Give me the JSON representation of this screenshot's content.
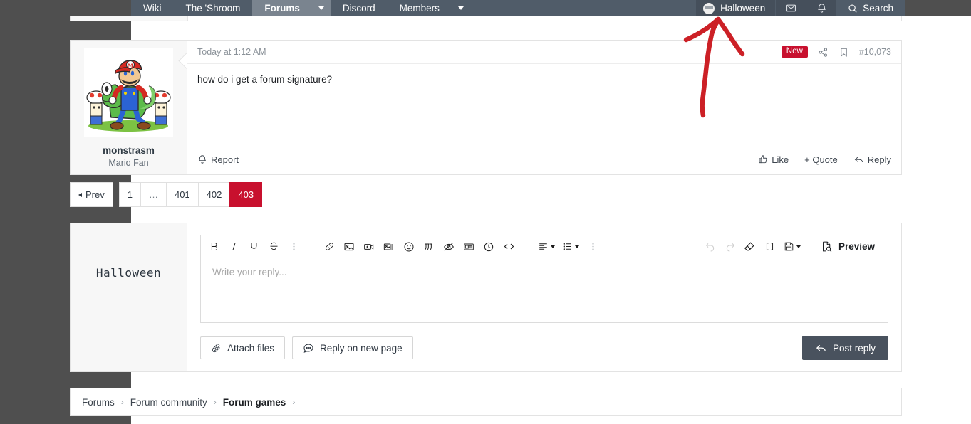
{
  "navbar": {
    "items": [
      {
        "label": "Wiki",
        "active": false,
        "caret": false
      },
      {
        "label": "The 'Shroom",
        "active": false,
        "caret": false
      },
      {
        "label": "Forums",
        "active": true,
        "caret": true
      },
      {
        "label": "Discord",
        "active": false,
        "caret": false
      },
      {
        "label": "Members",
        "active": false,
        "caret": true
      }
    ],
    "user": {
      "name": "Halloween",
      "avatar_icon": "user-avatar"
    },
    "inbox_icon": "envelope-icon",
    "alerts_icon": "bell-icon",
    "search": {
      "label": "Search",
      "icon": "search-icon"
    }
  },
  "post": {
    "author": "monstrasm",
    "user_title": "Mario Fan",
    "avatar_icon": "mario-yoshi-avatar",
    "date": "Today at 1:12 AM",
    "badge": "New",
    "share_icon": "share-icon",
    "bookmark_icon": "bookmark-icon",
    "post_number": "#10,073",
    "message": "how do i get a forum signature?",
    "report_label": "Report",
    "report_icon": "bell-icon",
    "like_label": "Like",
    "like_icon": "thumbs-up-icon",
    "quote_label": "+ Quote",
    "reply_label": "Reply",
    "reply_icon": "reply-arrow-icon"
  },
  "pagination": {
    "prev_label": "Prev",
    "pages": [
      "1",
      "…",
      "401",
      "402",
      "403"
    ],
    "current": "403"
  },
  "editor": {
    "username": "Halloween",
    "placeholder": "Write your reply...",
    "preview_label": "Preview",
    "preview_icon": "document-search-icon",
    "attach_label": "Attach files",
    "attach_icon": "paperclip-icon",
    "new_page_label": "Reply on new page",
    "new_page_icon": "comment-icon",
    "post_label": "Post reply",
    "post_icon": "reply-arrow-icon",
    "toolbar": [
      {
        "name": "bold-button",
        "glyph": "B",
        "disabled": false
      },
      {
        "name": "italic-button",
        "glyph": "I",
        "disabled": false
      },
      {
        "name": "underline-button",
        "glyph": "U",
        "disabled": false
      },
      {
        "name": "strikethrough-button",
        "glyph": "S",
        "disabled": false
      },
      {
        "name": "text-more-button",
        "glyph": "⋮",
        "disabled": false
      },
      {
        "name": "link-button",
        "glyph": "link",
        "disabled": false
      },
      {
        "name": "image-button",
        "glyph": "image",
        "disabled": false
      },
      {
        "name": "video-button",
        "glyph": "video",
        "disabled": false
      },
      {
        "name": "media-gallery-button",
        "glyph": "gallery",
        "disabled": false
      },
      {
        "name": "emoji-button",
        "glyph": "smile",
        "disabled": false
      },
      {
        "name": "quote-button",
        "glyph": "quote",
        "disabled": false
      },
      {
        "name": "spoiler-button",
        "glyph": "eye-slash",
        "disabled": false
      },
      {
        "name": "inline-spoiler-button",
        "glyph": "article",
        "disabled": false
      },
      {
        "name": "timestamp-button",
        "glyph": "clock",
        "disabled": false
      },
      {
        "name": "code-button",
        "glyph": "code",
        "disabled": false
      },
      {
        "name": "align-button",
        "glyph": "align",
        "disabled": false
      },
      {
        "name": "list-button",
        "glyph": "list",
        "disabled": false
      },
      {
        "name": "toolbar-more-button",
        "glyph": "⋮",
        "disabled": false
      },
      {
        "name": "undo-button",
        "glyph": "undo",
        "disabled": true
      },
      {
        "name": "redo-button",
        "glyph": "redo",
        "disabled": true
      },
      {
        "name": "remove-formatting-button",
        "glyph": "eraser",
        "disabled": false
      },
      {
        "name": "brackets-button",
        "glyph": "[ ]",
        "disabled": false
      },
      {
        "name": "drafts-button",
        "glyph": "floppy",
        "disabled": false
      }
    ]
  },
  "breadcrumb": [
    {
      "label": "Forums",
      "current": false
    },
    {
      "label": "Forum community",
      "current": false
    },
    {
      "label": "Forum games",
      "current": true
    }
  ],
  "annotation": {
    "color": "#cc2026",
    "shape": "hand-drawn-arrow-up"
  },
  "colors": {
    "nav_bg": "#505c69",
    "nav_active": "#7a848f",
    "accent_red": "#c8102e",
    "button_dark": "#49525e",
    "page_gutter": "#4f4f4f"
  }
}
